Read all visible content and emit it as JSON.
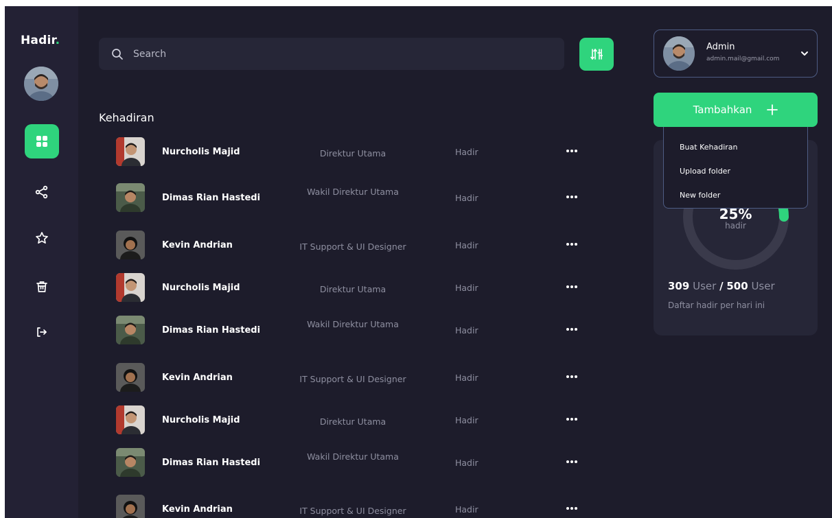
{
  "brand": {
    "name": "Hadir",
    "dot": "."
  },
  "search": {
    "placeholder": "Search"
  },
  "section_title": "Kehadiran",
  "rows": [
    {
      "name": "Nurcholis Majid",
      "role": "Direktur Utama",
      "status": "Hadir"
    },
    {
      "name": "Dimas Rian Hastedi",
      "role": "Wakil Direktur Utama",
      "status": "Hadir"
    },
    {
      "name": "Kevin Andrian",
      "role": "IT Support & UI Designer",
      "status": "Hadir"
    },
    {
      "name": "Nurcholis Majid",
      "role": "Direktur Utama",
      "status": "Hadir"
    },
    {
      "name": "Dimas Rian Hastedi",
      "role": "Wakil Direktur Utama",
      "status": "Hadir"
    },
    {
      "name": "Kevin Andrian",
      "role": "IT Support & UI Designer",
      "status": "Hadir"
    },
    {
      "name": "Nurcholis Majid",
      "role": "Direktur Utama",
      "status": "Hadir"
    },
    {
      "name": "Dimas Rian Hastedi",
      "role": "Wakil Direktur Utama",
      "status": "Hadir"
    },
    {
      "name": "Kevin Andrian",
      "role": "IT Support & UI Designer",
      "status": "Hadir"
    }
  ],
  "user": {
    "name": "Admin",
    "email": "admin.mail@gmail.com"
  },
  "add_button": {
    "label": "Tambahkan"
  },
  "dropdown": {
    "items": [
      "Buat Kehadiran",
      "Upload folder",
      "New folder"
    ]
  },
  "stats": {
    "percent": "25%",
    "percent_value": 25,
    "label": "hadir",
    "present": "309",
    "present_unit": "User",
    "total": "500",
    "total_unit": "User",
    "caption": "Daftar hadir per hari ini"
  },
  "colors": {
    "accent": "#2fd47d",
    "background": "#1d1c2b",
    "sidebar": "#232134",
    "card": "#262637"
  },
  "icons": [
    "dashboard-icon",
    "share-icon",
    "star-icon",
    "trash-icon",
    "logout-icon",
    "search-icon",
    "filter-icon",
    "chevron-down-icon",
    "plus-icon",
    "more-icon"
  ]
}
